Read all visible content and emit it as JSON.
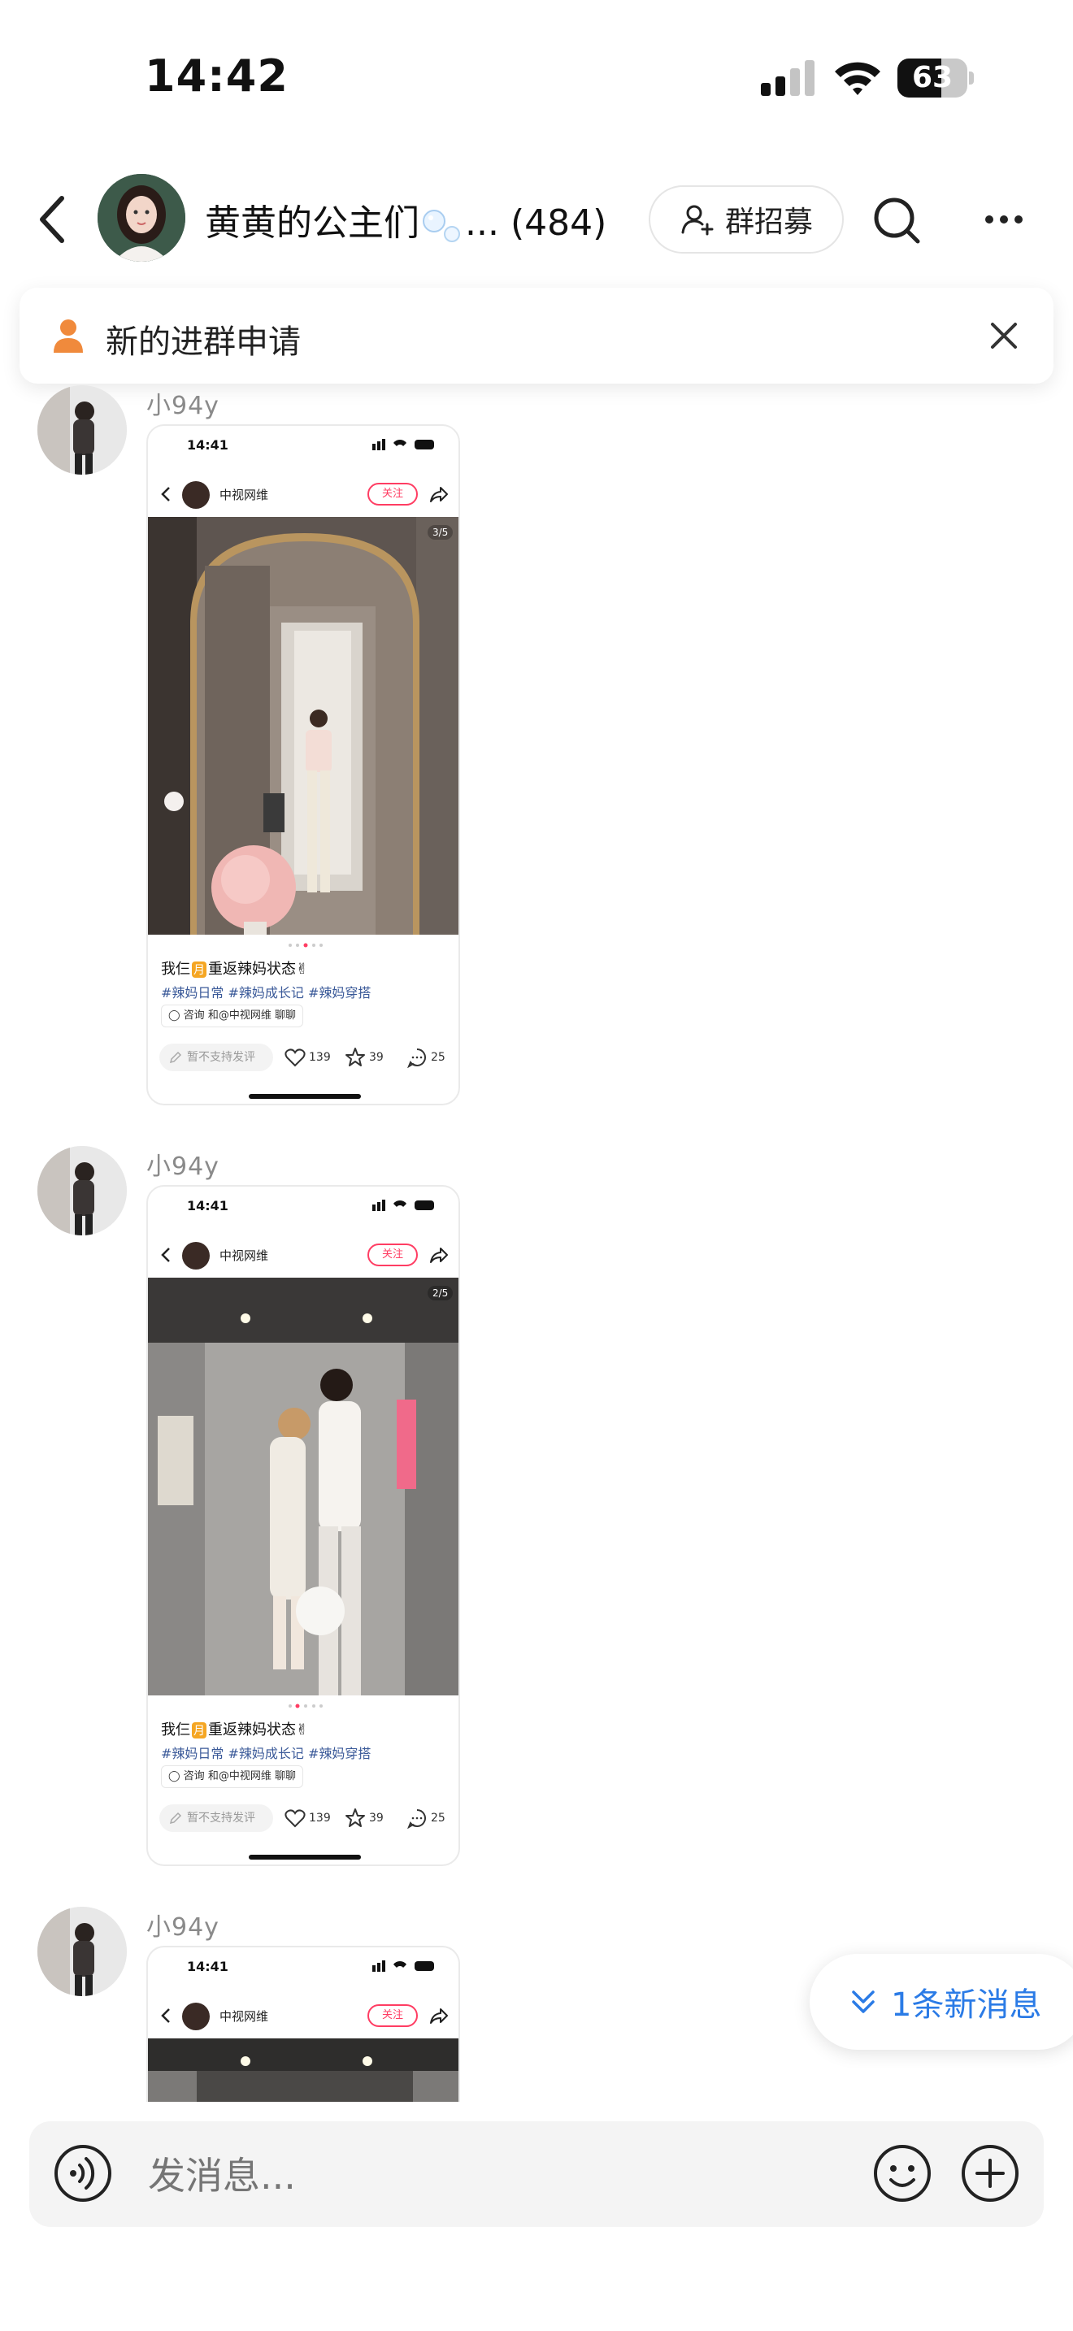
{
  "status_bar": {
    "time": "14:42",
    "battery": "63",
    "battery_level": 0.63
  },
  "header": {
    "title": "黄黄的公主们",
    "title_suffix": "... (484)",
    "recruit_label": "群招募"
  },
  "notice": {
    "text": "新的进群申请"
  },
  "messages": [
    {
      "sender": "小94y",
      "card": {
        "time": "14:41",
        "account": "中视网维",
        "follow": "关注",
        "page": "3/5",
        "caption_pre": "我仨",
        "caption_mark": "月",
        "caption_post": "重返辣妈状态✌",
        "tags": "#辣妈日常 #辣妈成长记 #辣妈穿搭",
        "consult": "◯ 咨询  和@中视网维 聊聊",
        "comment_placeholder": "暂不支持发评",
        "likes": "139",
        "stars": "39",
        "comments": "25"
      }
    },
    {
      "sender": "小94y",
      "card": {
        "time": "14:41",
        "account": "中视网维",
        "follow": "关注",
        "page": "2/5",
        "caption_pre": "我仨",
        "caption_mark": "月",
        "caption_post": "重返辣妈状态✌",
        "tags": "#辣妈日常 #辣妈成长记 #辣妈穿搭",
        "consult": "◯ 咨询  和@中视网维 聊聊",
        "comment_placeholder": "暂不支持发评",
        "likes": "139",
        "stars": "39",
        "comments": "25"
      }
    },
    {
      "sender": "小94y",
      "card": {
        "time": "14:41",
        "account": "中视网维",
        "follow": "关注"
      }
    }
  ],
  "new_messages": {
    "label": "1条新消息"
  },
  "input": {
    "placeholder": "发消息..."
  },
  "colors": {
    "accent_red": "#ff3d63",
    "link_blue": "#2b7be6",
    "notice_orange": "#f08a3c"
  },
  "icons": [
    "back-icon",
    "add-user-icon",
    "search-icon",
    "more-icon",
    "person-icon",
    "close-icon",
    "chevron-double-down-icon",
    "voice-icon",
    "emoji-icon",
    "plus-icon",
    "heart-icon",
    "star-icon",
    "comment-icon",
    "share-icon"
  ]
}
